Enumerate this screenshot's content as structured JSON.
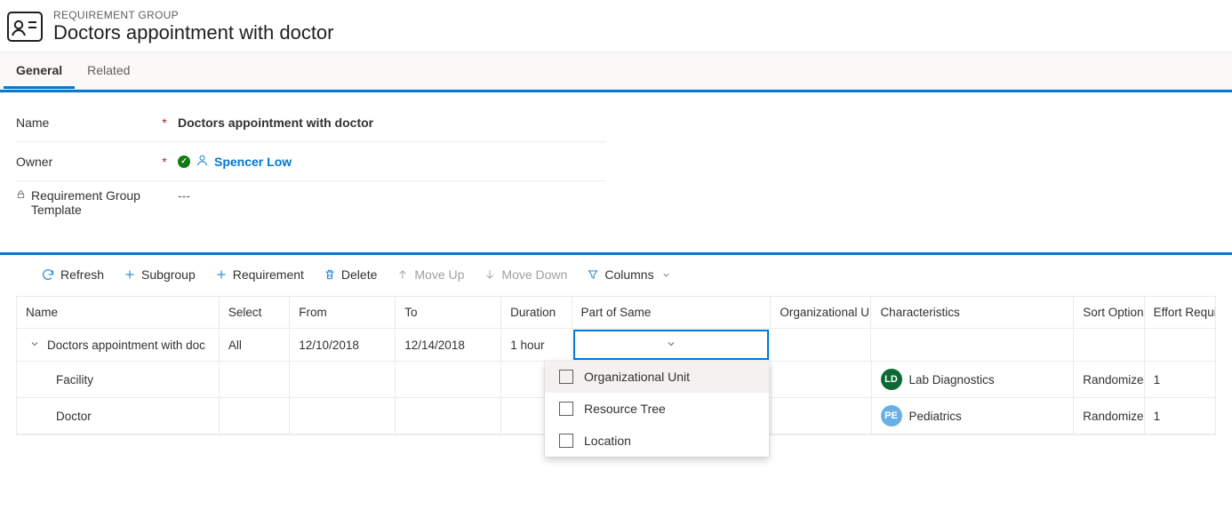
{
  "header": {
    "entity_label": "REQUIREMENT GROUP",
    "title": "Doctors appointment with doctor"
  },
  "tabs": {
    "general": "General",
    "related": "Related"
  },
  "form": {
    "name_label": "Name",
    "name_value": "Doctors appointment with doctor",
    "owner_label": "Owner",
    "owner_value": "Spencer Low",
    "template_label": "Requirement Group Template",
    "template_value": "---"
  },
  "toolbar": {
    "refresh": "Refresh",
    "subgroup": "Subgroup",
    "requirement": "Requirement",
    "delete": "Delete",
    "moveup": "Move Up",
    "movedown": "Move Down",
    "columns": "Columns"
  },
  "grid": {
    "headers": {
      "name": "Name",
      "select": "Select",
      "from": "From",
      "to": "To",
      "duration": "Duration",
      "part": "Part of Same",
      "org": "Organizational Unit",
      "char": "Characteristics",
      "sort": "Sort Option",
      "effort": "Effort Require"
    },
    "rows": [
      {
        "name": "Doctors appointment with doc",
        "select": "All",
        "from": "12/10/2018",
        "to": "12/14/2018",
        "duration": "1 hour",
        "part": "",
        "org": "",
        "char": "",
        "sort": "",
        "effort": ""
      },
      {
        "name": "Facility",
        "select": "",
        "from": "",
        "to": "",
        "duration": "",
        "part": "",
        "org": "",
        "char_badge": "LD",
        "char_text": "Lab Diagnostics",
        "sort": "Randomize",
        "effort": "1"
      },
      {
        "name": "Doctor",
        "select": "",
        "from": "",
        "to": "",
        "duration": "",
        "part": "",
        "org": "",
        "char_badge": "PE",
        "char_text": "Pediatrics",
        "sort": "Randomize",
        "effort": "1"
      }
    ]
  },
  "dropdown": {
    "opt1": "Organizational Unit",
    "opt2": "Resource Tree",
    "opt3": "Location"
  }
}
